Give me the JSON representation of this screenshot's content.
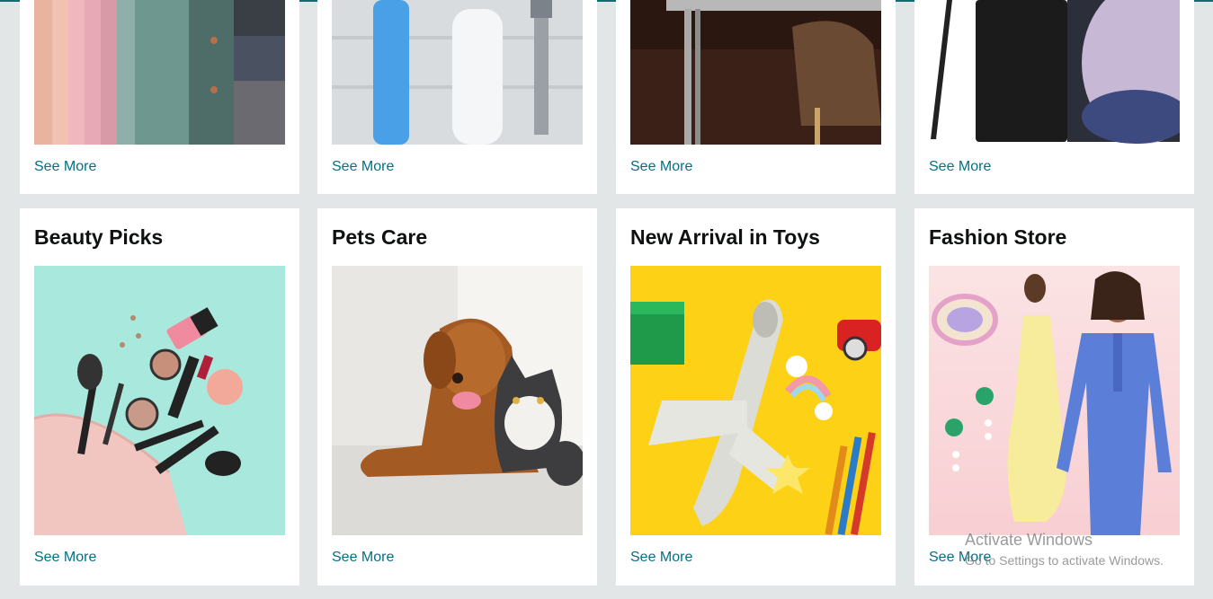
{
  "cards_top": [
    {
      "image": "fabric-curtains-photo",
      "link": "See More"
    },
    {
      "image": "toiletries-photo",
      "link": "See More"
    },
    {
      "image": "desk-chair-photo",
      "link": "See More"
    },
    {
      "image": "smartphone-photo",
      "link": "See More"
    }
  ],
  "cards_bottom": [
    {
      "title": "Beauty Picks",
      "image": "makeup-photo",
      "link": "See More"
    },
    {
      "title": "Pets Care",
      "image": "dog-and-cat-photo",
      "link": "See More"
    },
    {
      "title": "New Arrival in Toys",
      "image": "toy-airplane-photo",
      "link": "See More"
    },
    {
      "title": "Fashion Store",
      "image": "fashion-models-photo",
      "link": "See More"
    }
  ],
  "watermark": {
    "title": "Activate Windows",
    "subtitle": "Go to Settings to activate Windows."
  },
  "colors": {
    "page_bg": "#e3e6e6",
    "link": "#007185",
    "title": "#0f1111"
  }
}
